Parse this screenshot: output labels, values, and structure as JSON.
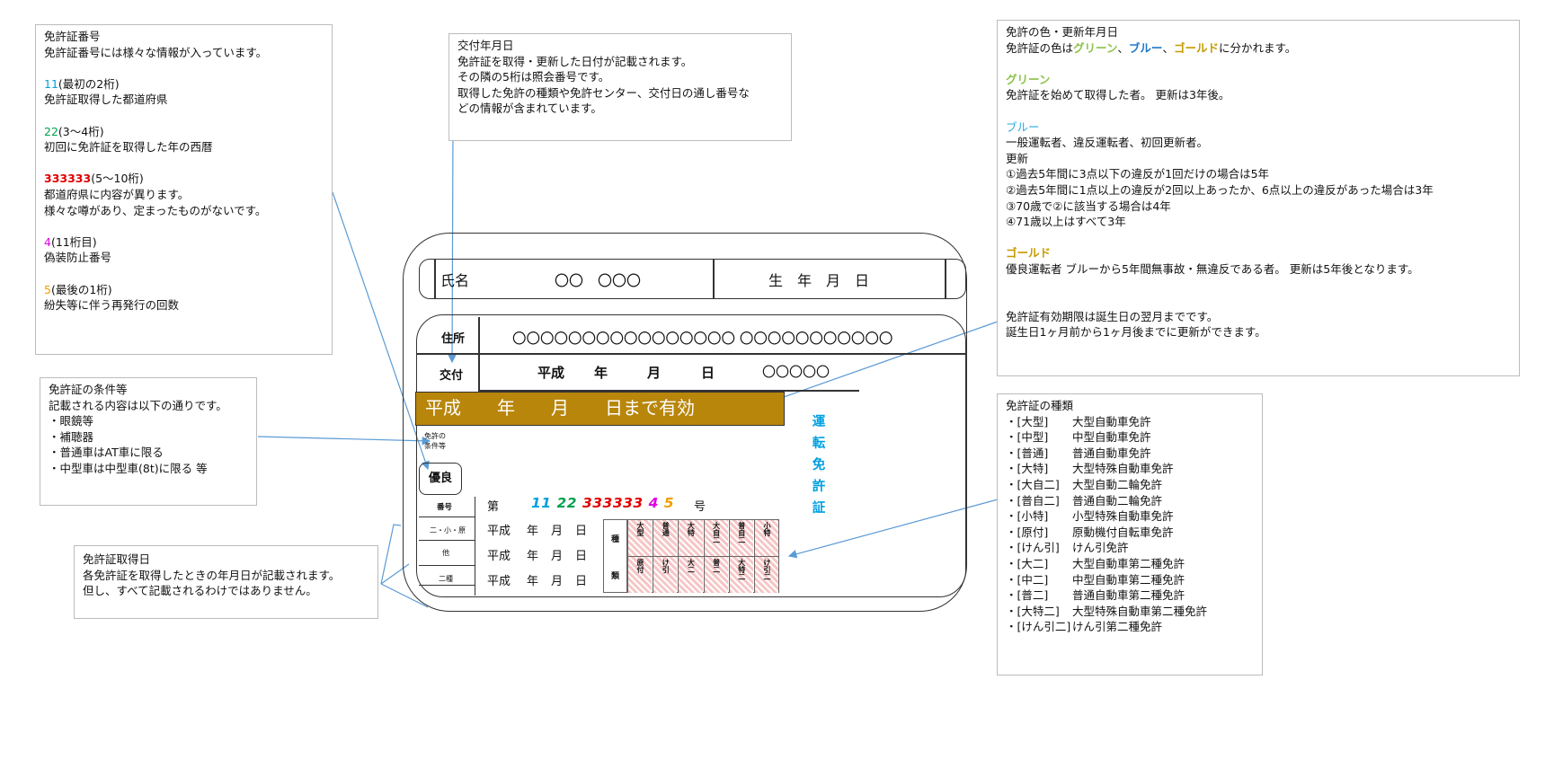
{
  "number_box": {
    "title": "免許証番号",
    "intro": "免許証番号には様々な情報が入っています。",
    "groups": [
      {
        "code": "11",
        "range": "(最初の2桁)",
        "lines": [
          "免許証取得した都道府県"
        ]
      },
      {
        "code": "22",
        "range": "(3～4桁)",
        "lines": [
          "初回に免許証を取得した年の西暦"
        ]
      },
      {
        "code": "333333",
        "range": "(5～10桁)",
        "lines": [
          "都道府県に内容が異ります。",
          "様々な噂があり、定まったものがないです。"
        ]
      },
      {
        "code": "4",
        "range": "(11桁目)",
        "lines": [
          "偽装防止番号"
        ]
      },
      {
        "code": "5",
        "range": "(最後の1桁)",
        "lines": [
          "紛失等に伴う再発行の回数"
        ]
      }
    ]
  },
  "issue_box": {
    "title": "交付年月日",
    "lines": [
      "免許証を取得・更新した日付が記載されます。",
      "その隣の5桁は照会番号です。",
      "取得した免許の種類や免許センター、交付日の通し番号な",
      "どの情報が含まれています。"
    ]
  },
  "conditions_box": {
    "title": "免許証の条件等",
    "intro": "記載される内容は以下の通りです。",
    "items": [
      "・眼鏡等",
      "・補聴器",
      "・普通車はAT車に限る",
      "・中型車は中型車(8t)に限る 等"
    ]
  },
  "acquired_box": {
    "title": "免許証取得日",
    "lines": [
      "各免許証を取得したときの年月日が記載されます。",
      "但し、すべて記載されるわけではありません。"
    ]
  },
  "color_box": {
    "title": "免許の色・更新年月日",
    "intro_prefix": "免許証の色は",
    "green": "グリーン",
    "sep1": "、",
    "blue": "ブルー",
    "sep2": "、",
    "gold": "ゴールド",
    "intro_suffix": "に分かれます。",
    "green_title": "グリーン",
    "green_desc": "免許証を始めて取得した者。 更新は3年後。",
    "blue_title": "ブルー",
    "blue_lines": [
      "一般運転者、違反運転者、初回更新者。",
      "更新",
      "①過去5年間に3点以下の違反が1回だけの場合は5年",
      "②過去5年間に1点以上の違反が2回以上あったか、6点以上の違反があった場合は3年",
      "③70歳で②に該当する場合は4年",
      "④71歳以上はすべて3年"
    ],
    "gold_title": "ゴールド",
    "gold_desc": "優良運転者 ブルーから5年間無事故・無違反である者。 更新は5年後となります。",
    "validity_lines": [
      "免許証有効期限は誕生日の翌月までです。",
      "誕生日1ヶ月前から1ヶ月後までに更新ができます。"
    ],
    "colors": {
      "green": "#8bc34a",
      "blue": "#1f78c8",
      "gold": "#c59b00",
      "blue_title": "#29a7e0"
    }
  },
  "types_box": {
    "title": "免許証の種類",
    "items": [
      {
        "code": "・[大型]",
        "name": "大型自動車免許"
      },
      {
        "code": "・[中型]",
        "name": "中型自動車免許"
      },
      {
        "code": "・[普通]",
        "name": "普通自動車免許"
      },
      {
        "code": "・[大特]",
        "name": "大型特殊自動車免許"
      },
      {
        "code": "・[大自二]",
        "name": "大型自動二輪免許"
      },
      {
        "code": "・[普自二]",
        "name": "普通自動二輪免許"
      },
      {
        "code": "・[小特]",
        "name": "小型特殊自動車免許"
      },
      {
        "code": "・[原付]",
        "name": "原動機付自転車免許"
      },
      {
        "code": "・[けん引]",
        "name": "けん引免許"
      },
      {
        "code": "・[大二]",
        "name": "大型自動車第二種免許"
      },
      {
        "code": "・[中二]",
        "name": "中型自動車第二種免許"
      },
      {
        "code": "・[普二]",
        "name": "普通自動車第二種免許"
      },
      {
        "code": "・[大特二]",
        "name": "大型特殊自動車第二種免許"
      },
      {
        "code": "・[けん引二]",
        "name": "けん引第二種免許"
      }
    ]
  },
  "card": {
    "name_label": "氏名",
    "name_value": "〇〇　〇〇〇",
    "birth_label": "生　年　月　日",
    "address_label": "住所",
    "address_value": "〇〇〇〇〇〇〇〇〇〇〇〇〇〇〇〇 〇〇〇〇〇〇〇〇〇〇〇",
    "issue_label": "交付",
    "issue_era": "平成",
    "issue_y": "年",
    "issue_m": "月",
    "issue_d": "日",
    "issue_serial": "〇〇〇〇〇",
    "validity_text": "平成　　年　　月　　日まで有効",
    "conditions_label": "免許の条件等",
    "excellent_label": "優良",
    "number_label": "番号",
    "number_prefix": "第",
    "number_parts": {
      "a": "11",
      "b": "22",
      "c": "333333",
      "d": "4",
      "e": "5"
    },
    "number_suffix": "号",
    "side_labels": [
      "二・小・原",
      "他",
      "二種"
    ],
    "date_rows": [
      {
        "era": "平成",
        "y": "年",
        "m": "月",
        "d": "日"
      },
      {
        "era": "平成",
        "y": "年",
        "m": "月",
        "d": "日"
      },
      {
        "era": "平成",
        "y": "年",
        "m": "月",
        "d": "日"
      }
    ],
    "kind_label_top": "種",
    "kind_label_bottom": "類",
    "kinds_top": [
      "大型",
      "普通",
      "大特",
      "大自二",
      "普自二",
      "小特"
    ],
    "kinds_bottom": [
      "原付",
      "け引",
      "大二",
      "普二",
      "大特二",
      "け引二"
    ],
    "title_vertical": [
      "運",
      "転",
      "免",
      "許",
      "証"
    ],
    "band_color": "#b8860b"
  }
}
